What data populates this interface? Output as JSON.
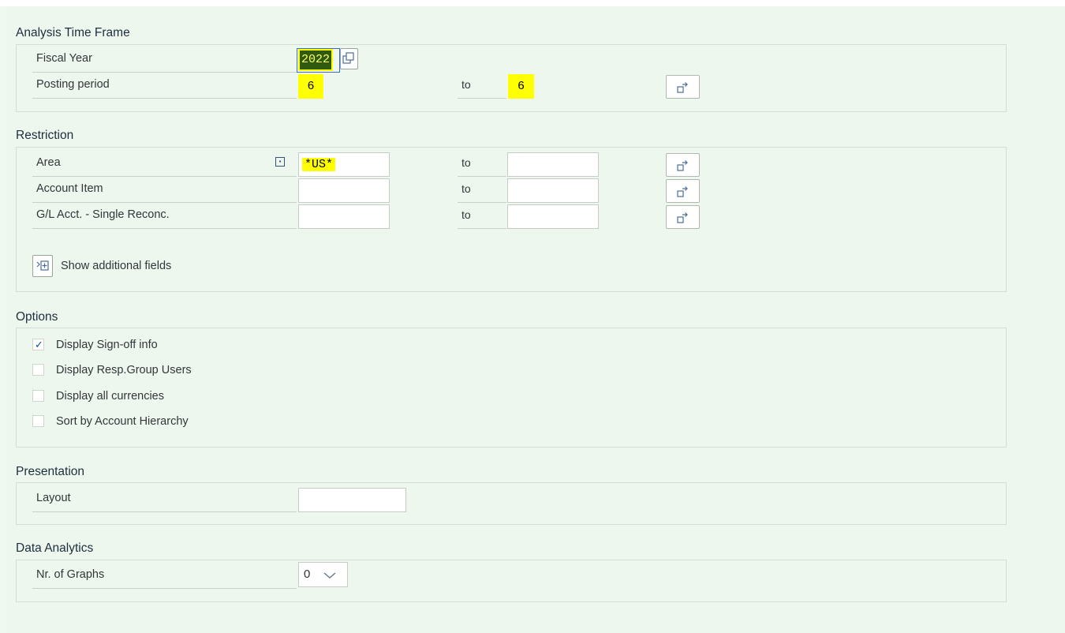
{
  "sections": {
    "time_frame": {
      "title": "Analysis Time Frame",
      "fiscal_year_label": "Fiscal Year",
      "fiscal_year_value": "2022",
      "posting_period_label": "Posting period",
      "posting_period_from": "6",
      "posting_period_to_label": "to",
      "posting_period_to": "6"
    },
    "restriction": {
      "title": "Restriction",
      "area_label": "Area",
      "area_from": "*US*",
      "area_to": "",
      "account_item_label": "Account Item",
      "account_item_from": "",
      "account_item_to": "",
      "gl_label": "G/L Acct. - Single Reconc.",
      "gl_from": "",
      "gl_to": "",
      "to_label": "to",
      "show_additional_label": "Show additional fields"
    },
    "options": {
      "title": "Options",
      "items": [
        {
          "label": "Display Sign-off info",
          "checked": true
        },
        {
          "label": "Display Resp.Group Users",
          "checked": false
        },
        {
          "label": "Display all currencies",
          "checked": false
        },
        {
          "label": "Sort by Account Hierarchy",
          "checked": false
        }
      ]
    },
    "presentation": {
      "title": "Presentation",
      "layout_label": "Layout",
      "layout_value": ""
    },
    "data_analytics": {
      "title": "Data Analytics",
      "graphs_label": "Nr. of Graphs",
      "graphs_value": "0"
    }
  },
  "colors": {
    "background": "#eef7ee",
    "highlight": "#ffff00",
    "focus_border": "#3b6fbf"
  }
}
